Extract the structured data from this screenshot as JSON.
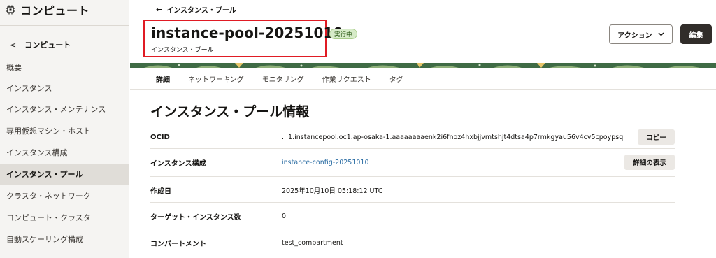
{
  "sidebar": {
    "title": "コンピュート",
    "back_label": "コンピュート",
    "items": [
      {
        "label": "概要"
      },
      {
        "label": "インスタンス"
      },
      {
        "label": "インスタンス・メンテナンス"
      },
      {
        "label": "専用仮想マシン・ホスト"
      },
      {
        "label": "インスタンス構成"
      },
      {
        "label": "インスタンス・プール",
        "active": true
      },
      {
        "label": "クラスタ・ネットワーク"
      },
      {
        "label": "コンピュート・クラスタ"
      },
      {
        "label": "自動スケーリング構成"
      }
    ]
  },
  "header": {
    "breadcrumb": "インスタンス・プール",
    "title": "instance-pool-20251010",
    "subtitle": "インスタンス・プール",
    "status_badge": "実行中",
    "status_color": "#d7ebc9",
    "actions_label": "アクション",
    "edit_label": "編集"
  },
  "tabs": [
    {
      "label": "詳細",
      "active": true
    },
    {
      "label": "ネットワーキング"
    },
    {
      "label": "モニタリング"
    },
    {
      "label": "作業リクエスト"
    },
    {
      "label": "タグ"
    }
  ],
  "info": {
    "section_title": "インスタンス・プール情報",
    "rows": [
      {
        "label": "OCID",
        "value": "...1.instancepool.oc1.ap-osaka-1.aaaaaaaaenk2i6fnoz4hxbjjvmtshjt4dtsa4p7rmkgyau56v4cv5cpoypsq",
        "button": "コピー"
      },
      {
        "label": "インスタンス構成",
        "value": "instance-config-20251010",
        "button": "詳細の表示"
      },
      {
        "label": "作成日",
        "value": "2025年10月10日 05:18:12 UTC"
      },
      {
        "label": "ターゲット・インスタンス数",
        "value": "0"
      },
      {
        "label": "コンパートメント",
        "value": "test_compartment"
      }
    ]
  }
}
